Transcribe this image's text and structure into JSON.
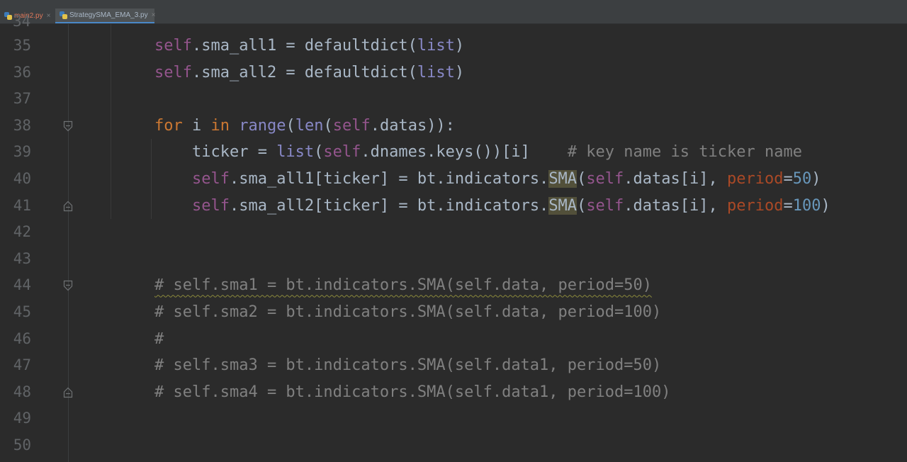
{
  "tabs": [
    {
      "label": "main2.py",
      "close": "×"
    },
    {
      "label": "StrategySMA_EMA_3.py",
      "close": "×"
    }
  ],
  "editor": {
    "partial_top_line": "34",
    "lines": [
      {
        "num": "35",
        "tokens": [
          {
            "t": "self",
            "c": "self"
          },
          {
            "t": ".sma_all1 = defaultdict(",
            "c": ""
          },
          {
            "t": "list",
            "c": "bi"
          },
          {
            "t": ")",
            "c": ""
          }
        ]
      },
      {
        "num": "36",
        "tokens": [
          {
            "t": "self",
            "c": "self"
          },
          {
            "t": ".sma_all2 = defaultdict(",
            "c": ""
          },
          {
            "t": "list",
            "c": "bi"
          },
          {
            "t": ")",
            "c": ""
          }
        ]
      },
      {
        "num": "37",
        "tokens": []
      },
      {
        "num": "38",
        "tokens": [
          {
            "t": "for",
            "c": "kw"
          },
          {
            "t": " i ",
            "c": ""
          },
          {
            "t": "in",
            "c": "kw"
          },
          {
            "t": " ",
            "c": ""
          },
          {
            "t": "range",
            "c": "bi"
          },
          {
            "t": "(",
            "c": ""
          },
          {
            "t": "len",
            "c": "bi"
          },
          {
            "t": "(",
            "c": ""
          },
          {
            "t": "self",
            "c": "self"
          },
          {
            "t": ".datas)):",
            "c": ""
          }
        ]
      },
      {
        "num": "39",
        "tokens": [
          {
            "t": "    ticker = ",
            "c": ""
          },
          {
            "t": "list",
            "c": "bi"
          },
          {
            "t": "(",
            "c": ""
          },
          {
            "t": "self",
            "c": "self"
          },
          {
            "t": ".dnames.keys())[i]    ",
            "c": ""
          },
          {
            "t": "# key name is ticker name",
            "c": "cmt"
          }
        ]
      },
      {
        "num": "40",
        "tokens": [
          {
            "t": "    ",
            "c": ""
          },
          {
            "t": "self",
            "c": "self"
          },
          {
            "t": ".sma_all1[ticker] = bt.indicators.",
            "c": ""
          },
          {
            "t": "SMA",
            "c": "hl"
          },
          {
            "t": "(",
            "c": ""
          },
          {
            "t": "self",
            "c": "self"
          },
          {
            "t": ".datas[i], ",
            "c": ""
          },
          {
            "t": "period",
            "c": "param"
          },
          {
            "t": "=",
            "c": ""
          },
          {
            "t": "50",
            "c": "num"
          },
          {
            "t": ")",
            "c": ""
          }
        ]
      },
      {
        "num": "41",
        "tokens": [
          {
            "t": "    ",
            "c": ""
          },
          {
            "t": "self",
            "c": "self"
          },
          {
            "t": ".sma_all2[ticker] = bt.indicators.",
            "c": ""
          },
          {
            "t": "SMA",
            "c": "hl"
          },
          {
            "t": "(",
            "c": ""
          },
          {
            "t": "self",
            "c": "self"
          },
          {
            "t": ".datas[i], ",
            "c": ""
          },
          {
            "t": "period",
            "c": "param"
          },
          {
            "t": "=",
            "c": ""
          },
          {
            "t": "100",
            "c": "num"
          },
          {
            "t": ")",
            "c": ""
          }
        ]
      },
      {
        "num": "42",
        "tokens": []
      },
      {
        "num": "43",
        "tokens": []
      },
      {
        "num": "44",
        "tokens": [
          {
            "t": "# self.sma1 = bt.indicators.SMA(self.data, period=50)",
            "c": "cmt wavy"
          }
        ]
      },
      {
        "num": "45",
        "tokens": [
          {
            "t": "# self.sma2 = bt.indicators.SMA(self.data, period=100)",
            "c": "cmt"
          }
        ]
      },
      {
        "num": "46",
        "tokens": [
          {
            "t": "#",
            "c": "cmt"
          }
        ]
      },
      {
        "num": "47",
        "tokens": [
          {
            "t": "# self.sma3 = bt.indicators.SMA(self.data1, period=50)",
            "c": "cmt"
          }
        ]
      },
      {
        "num": "48",
        "tokens": [
          {
            "t": "# self.sma4 = bt.indicators.SMA(self.data1, period=100)",
            "c": "cmt"
          }
        ]
      },
      {
        "num": "49",
        "tokens": []
      },
      {
        "num": "50",
        "tokens": []
      }
    ],
    "fold_markers": {
      "38": "open",
      "41": "close",
      "44": "open",
      "48": "close"
    }
  },
  "colors": {
    "background": "#2b2b2b",
    "keyword": "#cc7832",
    "self": "#94558d",
    "builtin": "#8888c6",
    "number": "#6897bb",
    "comment": "#808080",
    "param": "#aa4926"
  }
}
